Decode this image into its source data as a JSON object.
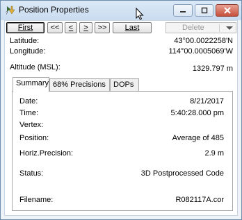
{
  "window": {
    "title": "Position Properties",
    "icon": "position-properties-icon",
    "controls": [
      "minimize-icon",
      "maximize-icon",
      "close-icon"
    ]
  },
  "toolbar": {
    "first_label": "First",
    "prev_many_label": "<<",
    "prev_label": "<",
    "next_label": ">",
    "next_many_label": ">>",
    "last_label": "Last",
    "delete_label": "Delete"
  },
  "position": {
    "latitude_label": "Latitude:",
    "latitude_value": "43°00.0022258'N",
    "longitude_label": "Longitude:",
    "longitude_value": "114°00.0005069'W",
    "altitude_label": "Altitude (MSL):",
    "altitude_value": "1329.797 m"
  },
  "tabs": [
    "Summary",
    "68% Precisions",
    "DOPs"
  ],
  "summary": {
    "date_label": "Date:",
    "date_value": "8/21/2017",
    "time_label": "Time:",
    "time_value": "5:40:28.000 pm",
    "vertex_label": "Vertex:",
    "vertex_value": "",
    "position_label": "Position:",
    "position_value": "Average of 485",
    "horiz_label": "Horiz.Precision:",
    "horiz_value": "2.9 m",
    "status_label": "Status:",
    "status_value": "3D Postprocessed Code",
    "filename_label": "Filename:",
    "filename_value": "R082117A.cor"
  },
  "colors": {
    "titlebar": "#c9dcf0",
    "close_button": "#c7503c",
    "window_border": "#6c8db0"
  }
}
